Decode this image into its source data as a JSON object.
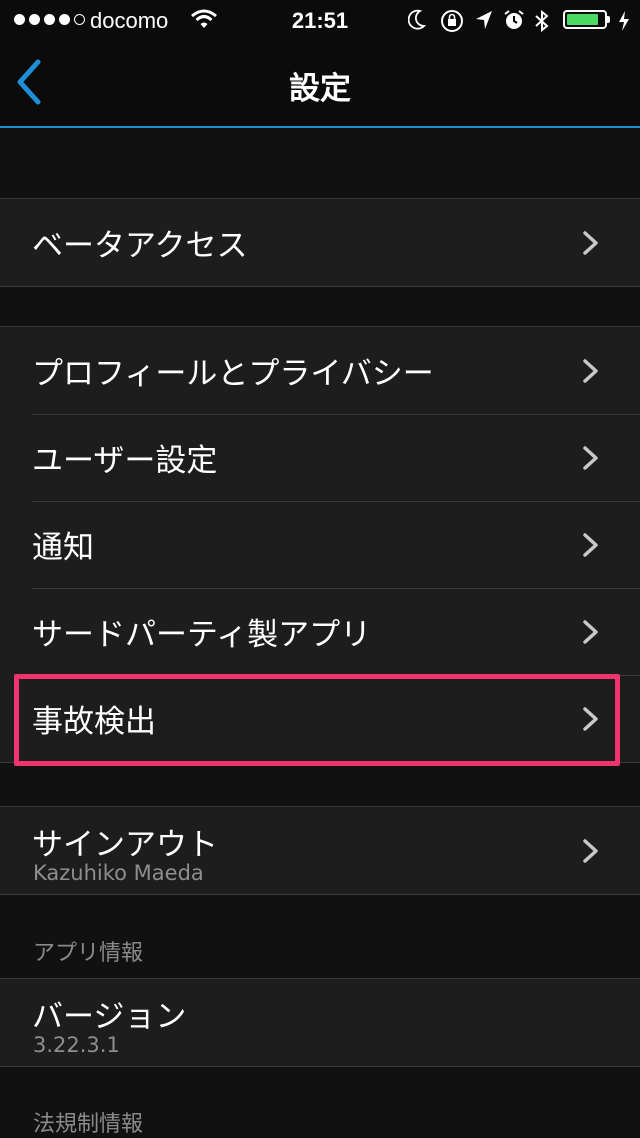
{
  "status_bar": {
    "carrier": "docomo",
    "time": "21:51",
    "battery_level": 0.85,
    "signal_bars": 4,
    "colors": {
      "battery": "#4cd964"
    },
    "icons": [
      "signal-dots-icon",
      "wifi-icon",
      "moon-icon",
      "rotation-lock-icon",
      "location-icon",
      "alarm-icon",
      "bluetooth-icon",
      "battery-icon",
      "charging-icon"
    ]
  },
  "nav": {
    "title": "設定",
    "back_icon": "chevron-left-icon",
    "colors": {
      "accent": "#1e8ed6"
    }
  },
  "groups": [
    {
      "items": [
        {
          "label": "ベータアクセス"
        }
      ]
    },
    {
      "items": [
        {
          "label": "プロフィールとプライバシー"
        },
        {
          "label": "ユーザー設定"
        },
        {
          "label": "通知"
        },
        {
          "label": "サードパーティ製アプリ"
        },
        {
          "label": "事故検出",
          "highlighted": true
        }
      ]
    },
    {
      "items": [
        {
          "label": "サインアウト",
          "sublabel": "Kazuhiko Maeda"
        }
      ]
    }
  ],
  "app_info": {
    "header": "アプリ情報",
    "version_label": "バージョン",
    "version_value": "3.22.3.1"
  },
  "legal": {
    "header": "法規制情報"
  },
  "highlight_color": "#ef3470"
}
